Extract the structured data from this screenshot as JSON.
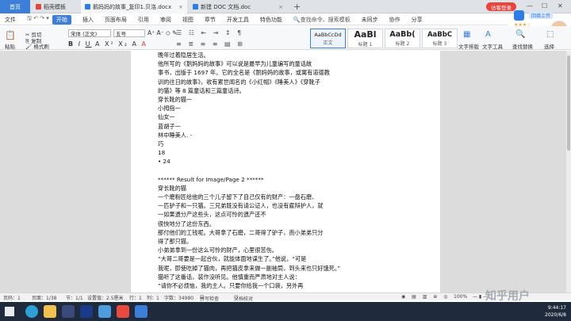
{
  "tabs": [
    {
      "label": "首页"
    },
    {
      "label": "稻壳模板"
    },
    {
      "label": "鹅妈妈的故事_复印1.贝洛.docx"
    },
    {
      "label": "新建 DOC 文档.doc"
    }
  ],
  "login_label": "访客登录",
  "cloud_label": "回填上传",
  "menu": [
    "文件",
    "开始",
    "插入",
    "页面布局",
    "引用",
    "审阅",
    "视图",
    "章节",
    "开发工具",
    "特色功能",
    "查找命令、搜索模板",
    "未同步",
    "协作",
    "分享"
  ],
  "ribbon": {
    "paste": "粘贴",
    "cut": "剪切",
    "copy": "复制",
    "format_painter": "格式刷",
    "font": "宋体 (正文)",
    "size": "五号",
    "styles": [
      {
        "preview": "AaBbCcDd",
        "name": "正文"
      },
      {
        "preview": "AaBl",
        "name": "标题 1"
      },
      {
        "preview": "AaBb(",
        "name": "标题 2"
      },
      {
        "preview": "AaBbC",
        "name": "标题 3"
      }
    ],
    "text_layout": "文字排版",
    "find_replace": "查找替换",
    "select": "选择",
    "text_tools": "文字工具"
  },
  "document": {
    "lines": [
      "晚年过着隐居生活。",
      "他所写的《鹅妈妈的故事》可以说是最早为儿童编写的童话故",
      "事书，出版于 1697 年。它的全名是《鹅妈妈的故事，或寓有道德教",
      "训的往日的故事》，收有累世闻名的《小红帽》《睡美人》《穿靴子",
      "的猫》等 8 篇童话和三篇童话诗。",
      "穿长靴的猫一",
      "小拇指一",
      "仙女一",
      "蓝胡子一",
      "林中睡美人.  -",
      "巧",
      "18",
      "• 24",
      "",
      "****** Result for Image/Page 2 ******",
      "穿长靴的猫",
      "一个磨粉匠给他的三个儿子留下了自己仅有的财产：一盘石磨、",
      "一匹驴子和一只猫。三兄弟既没有请公证人，也没有雇辩护人，就",
      "一如果遗分产这些头，这点可怜的遗产还不",
      "很快地分了这份东西。",
      "那付他们的工钱呢。大哥拿了石磨，二哥得了驴子，而小弟弟只分",
      "得了那只猫。",
      "小弟弟拿到一份这么可怜的财产，心里很苦伤。",
      "“大哥二哥要是一起合伙，就能体面地谋生了。”他说，“可是",
      "我呢，即使吃掉了猫肉，再把猫皮拿来做一副袖筒，到头来也只好饿死。”",
      "猫听了这番话，装作没听见。他慎重而严肃地对主人说：",
      "“请你不必烦恼，我的主人。只要你给我一个口袋，另外再"
    ]
  },
  "status": {
    "page_num": "页码：1",
    "page_count": "页面：1/38",
    "section": "节：1/1",
    "setting": "设置值：2.5厘米",
    "row": "行：1",
    "col": "列：1",
    "words": "字数：34980",
    "spell": "拼写检查",
    "doc_check": "文档校对",
    "zoom": "100%"
  },
  "taskbar": {
    "time": "9:44:17",
    "date": "2020/6/8"
  },
  "watermark": "知乎用户"
}
